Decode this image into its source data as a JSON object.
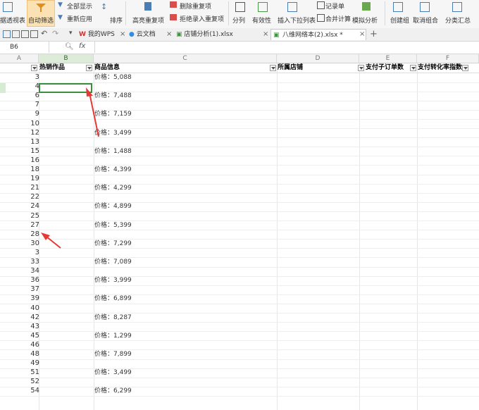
{
  "ribbon": {
    "pivot": "据透视表",
    "autofilter": "自动筛选",
    "show_all": "全部显示",
    "reapply": "重新应用",
    "sort": "排序",
    "highlight_dup": "高亮重复项",
    "delete_dup": "删除重复项",
    "reject_dup": "拒绝录入重复项",
    "split": "分列",
    "validation": "有效性",
    "insert_dropdown": "插入下拉列表",
    "record_form": "记录单",
    "consolidate": "合并计算",
    "whatif": "模拟分析",
    "group": "创建组",
    "ungroup": "取消组合",
    "subtotal": "分类汇总"
  },
  "tabs": [
    {
      "label": "我的WPS",
      "active": false
    },
    {
      "label": "云文档",
      "active": false
    },
    {
      "label": "店铺分析(1).xlsx",
      "active": false
    },
    {
      "label": "八维网络本(2).xlsx *",
      "active": true
    }
  ],
  "formula_bar": {
    "cell_ref": "B6",
    "fx": "fx",
    "value": ""
  },
  "columns": [
    "A",
    "B",
    "C",
    "D",
    "E",
    "F"
  ],
  "headers": {
    "col_b": "热销作品",
    "col_c": "商品信息",
    "col_d": "所属店铺",
    "col_e": "支付子订单数",
    "col_f": "支付转化率指数"
  },
  "rows": [
    {
      "num": "3",
      "price": "价格：5,088"
    },
    {
      "num": "4",
      "price": ""
    },
    {
      "num": "6",
      "price": "价格：7,488"
    },
    {
      "num": "7",
      "price": ""
    },
    {
      "num": "9",
      "price": "价格：7,159"
    },
    {
      "num": "10",
      "price": ""
    },
    {
      "num": "12",
      "price": "价格：3,499"
    },
    {
      "num": "13",
      "price": ""
    },
    {
      "num": "15",
      "price": "价格：1,488"
    },
    {
      "num": "16",
      "price": ""
    },
    {
      "num": "18",
      "price": "价格：4,399"
    },
    {
      "num": "19",
      "price": ""
    },
    {
      "num": "21",
      "price": "价格：4,299"
    },
    {
      "num": "22",
      "price": ""
    },
    {
      "num": "24",
      "price": "价格：4,899"
    },
    {
      "num": "25",
      "price": ""
    },
    {
      "num": "27",
      "price": "价格：5,399"
    },
    {
      "num": "28",
      "price": ""
    },
    {
      "num": "30",
      "price": "价格：7,299"
    },
    {
      "num": "3",
      "price": ""
    },
    {
      "num": "33",
      "price": "价格：7,089"
    },
    {
      "num": "34",
      "price": ""
    },
    {
      "num": "36",
      "price": "价格：3,999"
    },
    {
      "num": "37",
      "price": ""
    },
    {
      "num": "39",
      "price": "价格：6,899"
    },
    {
      "num": "40",
      "price": ""
    },
    {
      "num": "42",
      "price": "价格：8,287"
    },
    {
      "num": "43",
      "price": ""
    },
    {
      "num": "45",
      "price": "价格：1,299"
    },
    {
      "num": "46",
      "price": ""
    },
    {
      "num": "48",
      "price": "价格：7,899"
    },
    {
      "num": "49",
      "price": ""
    },
    {
      "num": "51",
      "price": "价格：3,499"
    },
    {
      "num": "52",
      "price": ""
    },
    {
      "num": "54",
      "price": "价格：6,299"
    }
  ],
  "colors": {
    "selection": "#3c8d3c",
    "annotation_arrow": "#e53935",
    "active_button": "#fbe2b4"
  }
}
